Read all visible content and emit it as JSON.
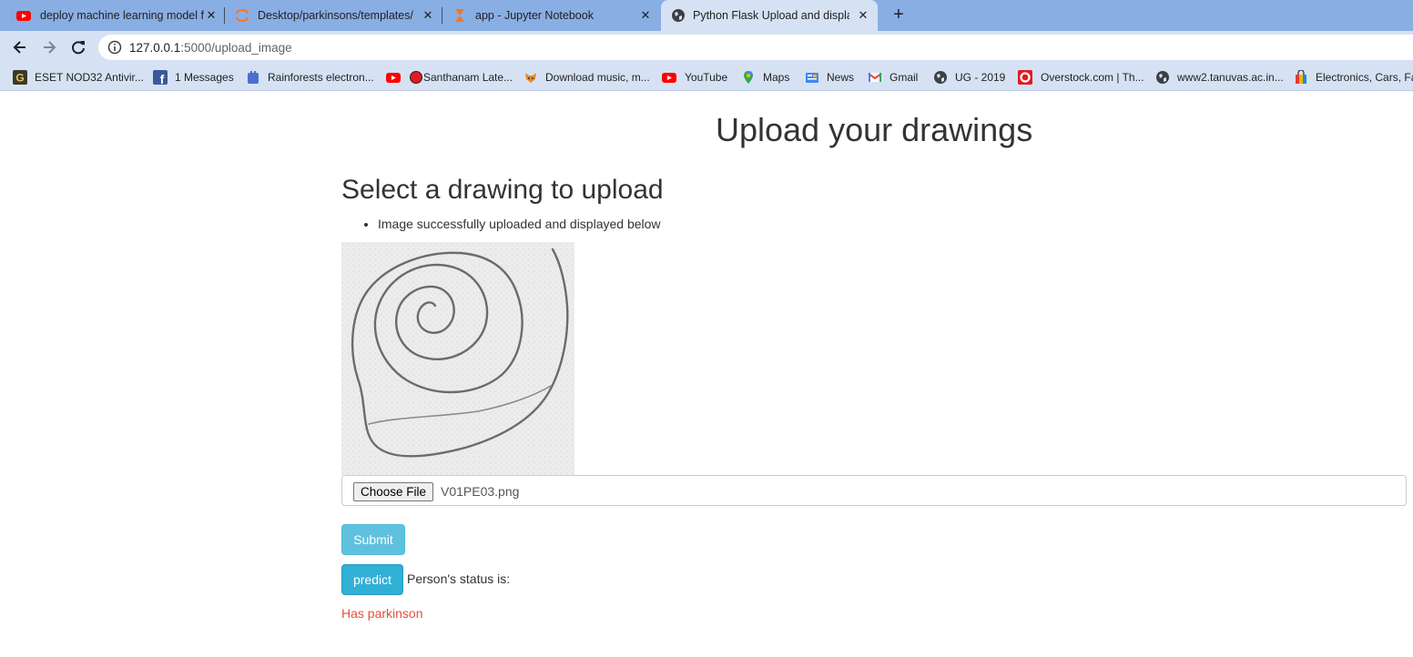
{
  "browser": {
    "tabs": [
      {
        "title": "deploy machine learning model f",
        "favicon": "youtube-icon"
      },
      {
        "title": "Desktop/parkinsons/templates/",
        "favicon": "jupyter-icon"
      },
      {
        "title": "app - Jupyter Notebook",
        "favicon": "hourglass-icon"
      },
      {
        "title": "Python Flask Upload and display",
        "favicon": "globe-icon"
      }
    ],
    "active_tab": 3,
    "url_host": "127.0.0.1",
    "url_path": ":5000/upload_image",
    "bookmarks": [
      {
        "label": "ESET NOD32 Antivir...",
        "icon": "eset-icon"
      },
      {
        "label": "1 Messages",
        "icon": "facebook-icon"
      },
      {
        "label": "Rainforests electron...",
        "icon": "bookmark-app-icon"
      },
      {
        "label": "Santhanam Late...",
        "icon": "youtube-icon"
      },
      {
        "label": "Download music, m...",
        "icon": "fox-icon"
      },
      {
        "label": "YouTube",
        "icon": "youtube-icon"
      },
      {
        "label": "Maps",
        "icon": "maps-pin-icon"
      },
      {
        "label": "News",
        "icon": "news-icon"
      },
      {
        "label": "Gmail",
        "icon": "gmail-icon"
      },
      {
        "label": "UG - 2019",
        "icon": "globe-icon"
      },
      {
        "label": "Overstock.com | Th...",
        "icon": "overstock-icon"
      },
      {
        "label": "www2.tanuvas.ac.in...",
        "icon": "globe-icon"
      },
      {
        "label": "Electronics, Cars, Fa...",
        "icon": "shopping-bag-icon"
      }
    ]
  },
  "page": {
    "title": "Upload your drawings",
    "subtitle": "Select a drawing to upload",
    "flash_message": "Image successfully uploaded and displayed below",
    "choose_file_label": "Choose File",
    "file_name": "V01PE03.png",
    "submit_label": "Submit",
    "predict_label": "predict",
    "status_label": "Person's status is:",
    "result_text": "Has parkinson",
    "result_color": "#e0513f",
    "button_color": "#5bc0de"
  }
}
